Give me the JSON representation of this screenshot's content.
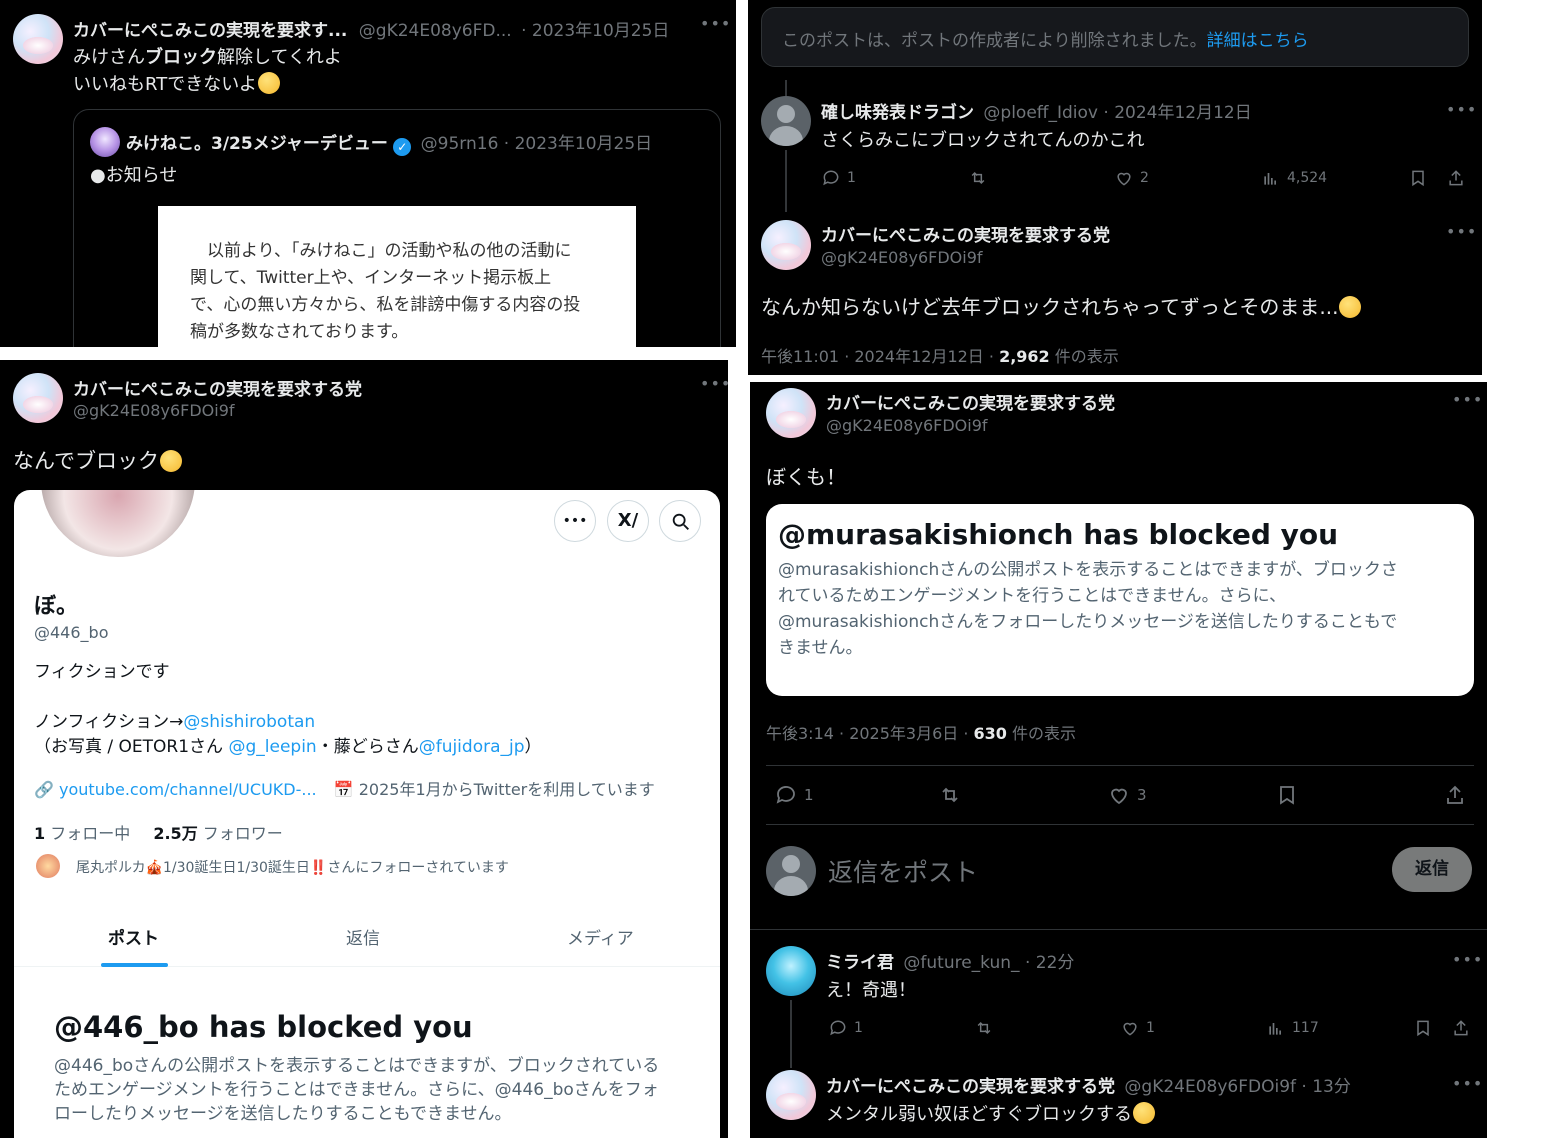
{
  "p1": {
    "author_name": "カバーにぺこみこの実現を要求す...",
    "author_handle": "@gK24E08y6FD...",
    "date": "· 2023年10月25日",
    "text_line1_pre": "みけさん",
    "text_line1_bold": "ブロック",
    "text_line1_post": "解除してくれよ",
    "text_line2": "いいねもRTできないよ",
    "quote": {
      "name": "みけねこ。3/25メジャーデビュー",
      "handle": "@95rn16 · 2023年10月25日",
      "text": "●お知らせ",
      "image_lines": [
        "　以前より、「みけねこ」の活動や私の他の活動に",
        "関して、Twitter上や、インターネット掲示板上",
        "で、心の無い方々から、私を誹謗中傷する内容の投",
        "稿が多数なされております。"
      ]
    }
  },
  "p2": {
    "deleted_notice": "このポストは、ポストの作成者により削除されました。",
    "deleted_link": "詳細はこちら",
    "reply1": {
      "name": "確し味発表ドラゴン",
      "handle": "@ploeff_Idiov · 2024年12月12日",
      "text": "さくらみこにブロックされてんのかこれ",
      "replies": "1",
      "likes": "2",
      "views": "4,524"
    },
    "main": {
      "name": "カバーにぺこみこの実現を要求する党",
      "handle": "@gK24E08y6FDOi9f",
      "text": "なんか知らないけど去年ブロックされちゃってずっとそのまま...",
      "meta_pre": "午後11:01 · 2024年12月12日 · ",
      "views": "2,962",
      "meta_post": " 件の表示"
    }
  },
  "p3": {
    "name": "カバーにぺこみこの実現を要求する党",
    "handle": "@gK24E08y6FDOi9f",
    "text": "なんでブロック",
    "profile": {
      "display_name": "ぼ。",
      "handle": "@446_bo",
      "bio1": "フィクションです",
      "bio2_pre": "ノンフィクション→",
      "bio2_link": "@shishirobotan",
      "bio3_pre": "（お写真 / OETOR1さん ",
      "bio3_link1": "@g_leepin",
      "bio3_mid": "・藤どらさん",
      "bio3_link2": "@fujidora_jp",
      "bio3_post": "）",
      "website": "youtube.com/channel/UCUKD-...",
      "joined": "2025年1月からTwitterを利用しています",
      "following_count": "1",
      "following_label": "フォロー中",
      "followers_count": "2.5万",
      "followers_label": "フォロワー",
      "followed_by": "尾丸ポルカ🎪1/30誕生日1/30誕生日‼️さんにフォローされています",
      "tabs": [
        "ポスト",
        "返信",
        "メディア"
      ],
      "blocked_title": "@446_bo has blocked you",
      "blocked_body": [
        "@446_boさんの公開ポストを表示することはできますが、ブロックされている",
        "ためエンゲージメントを行うことはできません。さらに、@446_boさんをフォ",
        "ローしたりメッセージを送信したりすることもできません。"
      ]
    }
  },
  "p4": {
    "name": "カバーにぺこみこの実現を要求する党",
    "handle": "@gK24E08y6FDOi9f",
    "text": "ぼくも！",
    "blocked_title": "@murasakishionch has blocked you",
    "blocked_body": [
      "@murasakishionchさんの公開ポストを表示することはできますが、ブロックさ",
      "れているためエンゲージメントを行うことはできません。さらに、",
      "@murasakishionchさんをフォローしたりメッセージを送信したりすることもで",
      "きません。"
    ],
    "meta_pre": "午後3:14 · 2025年3月6日 · ",
    "views": "630",
    "meta_post": " 件の表示",
    "replies": "1",
    "likes": "3",
    "reply_placeholder": "返信をポスト",
    "reply_button": "返信",
    "r1": {
      "name": "ミライ君",
      "handle": "@future_kun_ · 22分",
      "text": "え！奇遇！",
      "replies": "1",
      "likes": "1",
      "views": "117"
    },
    "r2": {
      "name": "カバーにぺこみこの実現を要求する党",
      "handle": "@gK24E08y6FDOi9f · 13分",
      "text": "メンタル弱い奴ほどすぐブロックする"
    }
  }
}
